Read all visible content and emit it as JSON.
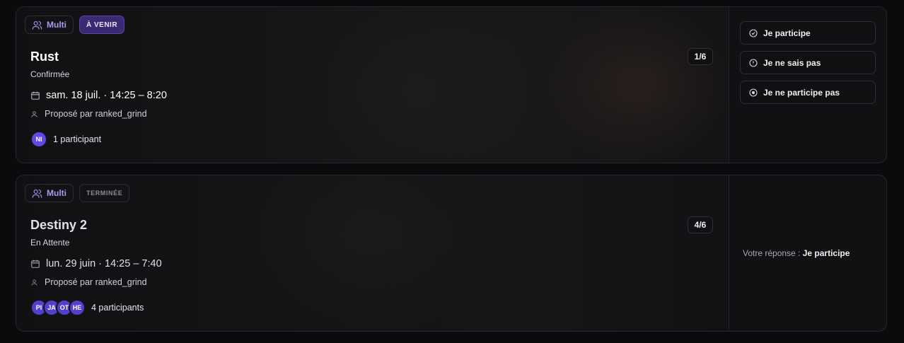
{
  "events": [
    {
      "mode_label": "Multi",
      "state_label": "À VENIR",
      "title": "Rust",
      "status": "Confirmée",
      "datetime": "sam. 18 juil. · 14:25 – 8:20",
      "proposed_by": "Proposé par ranked_grind",
      "slots": "1/6",
      "avatars": [
        "NI"
      ],
      "participants_label": "1 participant",
      "actions": [
        {
          "icon": "check-circle-icon",
          "label": "Je participe"
        },
        {
          "icon": "alert-circle-icon",
          "label": "Je ne sais pas"
        },
        {
          "icon": "x-circle-icon",
          "label": "Je ne participe pas"
        }
      ]
    },
    {
      "mode_label": "Multi",
      "state_label": "TERMINÉE",
      "title": "Destiny 2",
      "status": "En Attente",
      "datetime": "lun. 29 juin · 14:25 – 7:40",
      "proposed_by": "Proposé par ranked_grind",
      "slots": "4/6",
      "avatars": [
        "PI",
        "JA",
        "OT",
        "HE"
      ],
      "participants_label": "4 participants",
      "response_label": "Votre réponse :",
      "response_value": "Je participe"
    }
  ],
  "colors": {
    "accent": "#6248e8",
    "upcoming_badge": "#3a2a72",
    "multi_text": "#a79bf0"
  }
}
